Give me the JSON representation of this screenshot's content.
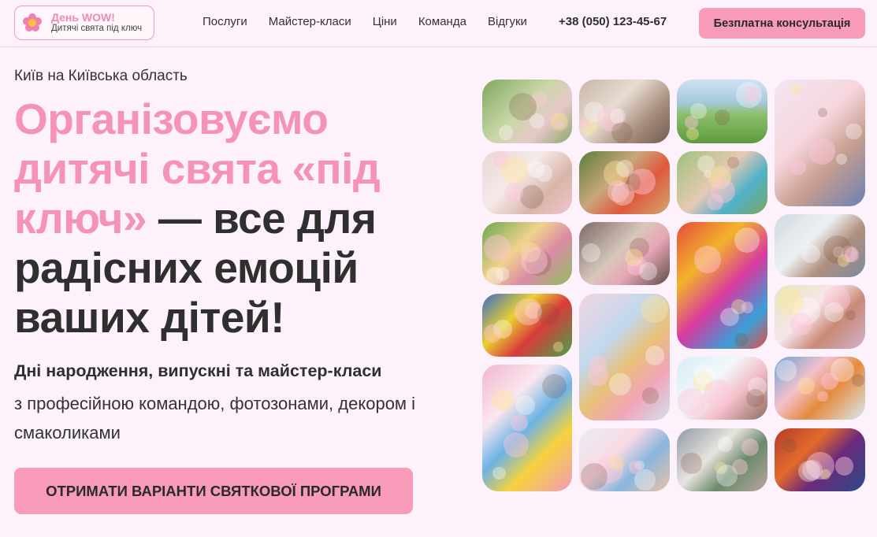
{
  "brand": {
    "title": "День WOW!",
    "subtitle": "Дитячі свята під ключ"
  },
  "nav": {
    "items": [
      "Послуги",
      "Майстер-класи",
      "Ціни",
      "Команда",
      "Відгуки"
    ],
    "phone": "+38 (050) 123-45-67",
    "cta": "Безплатна консультація"
  },
  "hero": {
    "location": "Київ на Київська область",
    "headline_pink": "Організовуємо дитячі свята «під ключ»",
    "headline_dark": " — все для радісних емоцій ваших дітей!",
    "sub_strong": "Дні народження, випускні та майстер-класи",
    "sub_text": "з професійною командою, фотозонами, декором і смаколиками",
    "cta": "ОТРИМАТИ ВАРІАНТИ СВЯТКОВОЇ ПРОГРАМИ"
  },
  "colors": {
    "accent": "#f79bb8",
    "headline_pink": "#f493b7",
    "background": "#fdf1fb",
    "text": "#2f2f2f"
  },
  "gallery": [
    {
      "name": "photo-kids-garden-party",
      "bg": "linear-gradient(135deg,#7fa860,#c9d7a6 45%,#e7c8c9 70%,#8aa86a)"
    },
    {
      "name": "photo-kids-at-table",
      "bg": "linear-gradient(135deg,#c7b6a7,#e8ddd2 40%,#a88d7d 70%,#6e5b4f)"
    },
    {
      "name": "photo-kids-running-field",
      "bg": "linear-gradient(180deg,#cfe2f1,#a7c9e0 35%,#8cbf6a 55%,#5d9a3e)"
    },
    {
      "name": "photo-two-girls-balloons",
      "bg": "linear-gradient(135deg,#f1e6f0,#f7d7df 40%,#c89f8f 65%,#6b80b3)"
    },
    {
      "name": "photo-kids-confetti",
      "bg": "linear-gradient(135deg,#e9d7d7,#f5e9ea 40%,#d8b5a8 70%,#f1c6cf)"
    },
    {
      "name": "photo-kids-birthday-cake",
      "bg": "linear-gradient(135deg,#5a7d3a,#c9a77b 40%,#e0593e 65%,#d0a872)"
    },
    {
      "name": "photo-kids-cheering",
      "bg": "linear-gradient(135deg,#9cc27a,#e6c9b4 45%,#4fb1c8 70%,#7aa860)"
    },
    {
      "name": "photo-outdoor-party-table",
      "bg": "linear-gradient(135deg,#6aa84f,#f1d28e 40%,#d98ba5 65%,#8fbf5d)"
    },
    {
      "name": "photo-kids-party-room",
      "bg": "linear-gradient(135deg,#7a6a66,#d8c7bb 45%,#e7a6b6 65%,#5c4d48)"
    },
    {
      "name": "photo-balloon-animals",
      "bg": "linear-gradient(135deg,#e64b3c,#f3b32b 30%,#d83aa0 55%,#3aa0d8 80%,#e64b3c)"
    },
    {
      "name": "photo-kids-dancing",
      "bg": "linear-gradient(135deg,#cfd9df,#eef1f4 40%,#b0907e 65%,#7c8aa0)"
    },
    {
      "name": "photo-parachute-game",
      "bg": "linear-gradient(135deg,#3a6cc7,#e9d12f 35%,#d93b3b 60%,#49a34a)"
    },
    {
      "name": "photo-kids-lying-confetti",
      "bg": "linear-gradient(135deg,#f2d6e0,#c1d8ee 35%,#e8c07a 55%,#f1a5b8 75%,#d0e0f0)"
    },
    {
      "name": "photo-party-decor-kids",
      "bg": "linear-gradient(135deg,#e6e8b8,#f6e5ea 40%,#c98a76 65%,#d2b0d0)"
    },
    {
      "name": "photo-candy-bar",
      "bg": "linear-gradient(135deg,#f3b5cf,#f9e7ef 30%,#6db3e6 50%,#f7d23c 70%,#f09ab8)"
    },
    {
      "name": "photo-girl-with-cake",
      "bg": "linear-gradient(135deg,#d7eef7,#f2f7fa 40%,#f3bcc8 65%,#8c6d5d)"
    },
    {
      "name": "photo-kids-table-fruits",
      "bg": "linear-gradient(135deg,#6aa2d8,#f3c1cc 35%,#e58a3d 60%,#d9e9f2)"
    },
    {
      "name": "photo-kids-hands-up",
      "bg": "linear-gradient(135deg,#e8eef3,#f9d9e4 40%,#8ab7df 65%,#e9c0a5)"
    },
    {
      "name": "photo-family-party",
      "bg": "linear-gradient(135deg,#8e9aa6,#e8e4e0 40%,#6a8a6a 65%,#b8a6a0)"
    },
    {
      "name": "photo-costume-party",
      "bg": "linear-gradient(135deg,#b33a2a,#e36a2a 35%,#6b2a7a 60%,#2a4a8a)"
    }
  ]
}
